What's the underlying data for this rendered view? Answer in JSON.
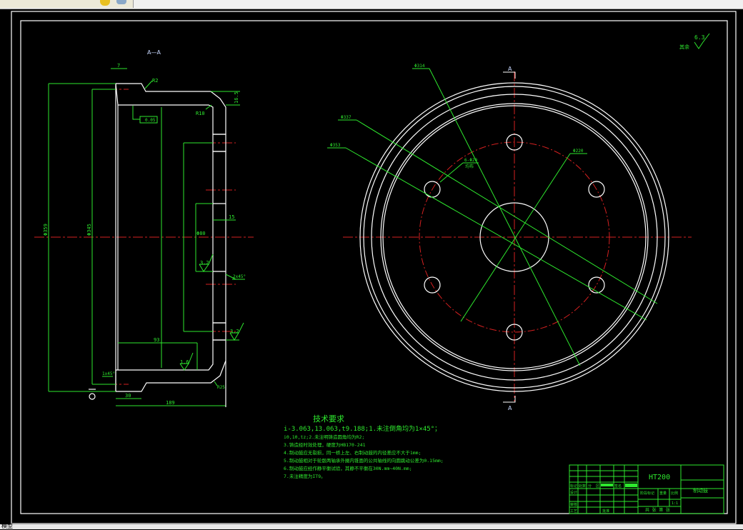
{
  "toolbar": {
    "icons": [
      "layer-icon",
      "layer-properties-icon"
    ]
  },
  "status_bar": {
    "text": "模型"
  },
  "section_view": {
    "title": "A—A",
    "dims": {
      "d359": "Φ359",
      "d345": "Φ345",
      "w7": "7",
      "r2": "R2",
      "h16_5": "16.5",
      "r10": "R10",
      "tol": "0.05",
      "d80": "Φ80",
      "d15": "15",
      "ra32a": "3.2",
      "chamfer": "2x45°",
      "ra32b": "3.2",
      "w93": "93",
      "ra16": "1.6",
      "chamfer2": "1x45°",
      "w30": "30",
      "r25": "R25",
      "w189": "189"
    }
  },
  "front_view": {
    "section_mark": "A",
    "dims": {
      "d314": "Φ314",
      "d337": "Φ337",
      "d353": "Φ353",
      "holes": "6-Φ20",
      "holes_note": "均布",
      "pcd": "Φ220"
    }
  },
  "roughness": {
    "label": "其余",
    "value": "6.3"
  },
  "tech_requirements": {
    "title": "技术要求",
    "lines": [
      "i-3.063,13.063,t9.188;1.未注倒角均为1×45°；",
      "i0,10,tz;2.未注明铸造圆角均为R2;",
      "3.铸造经时效处理，硬度为HB170-241",
      "4.制动鼓应无裂损，同一桥上左、右制动鼓的内径差应不大于1mm;",
      "5.制动鼓相对于轮毂两轴承外圈内锥面的公共轴线的向圆跳动公差为0.15mm;",
      "6.制动鼓应经作静平衡试验，其静不平衡在30N.mm~40N.mm;",
      "7.未注精度为IT9。"
    ]
  },
  "title_block": {
    "material": "HT200",
    "part_name": "制动鼓",
    "headers": [
      "标记",
      "处数",
      "分",
      "区",
      "签名"
    ],
    "rows": [
      "设计",
      "审核",
      "工艺"
    ],
    "date_label": "批准",
    "stage_label": "阶段标记",
    "weight_label": "重量",
    "scale_label": "比例",
    "scale": "1:1",
    "sheets": "共 张 第 张"
  }
}
